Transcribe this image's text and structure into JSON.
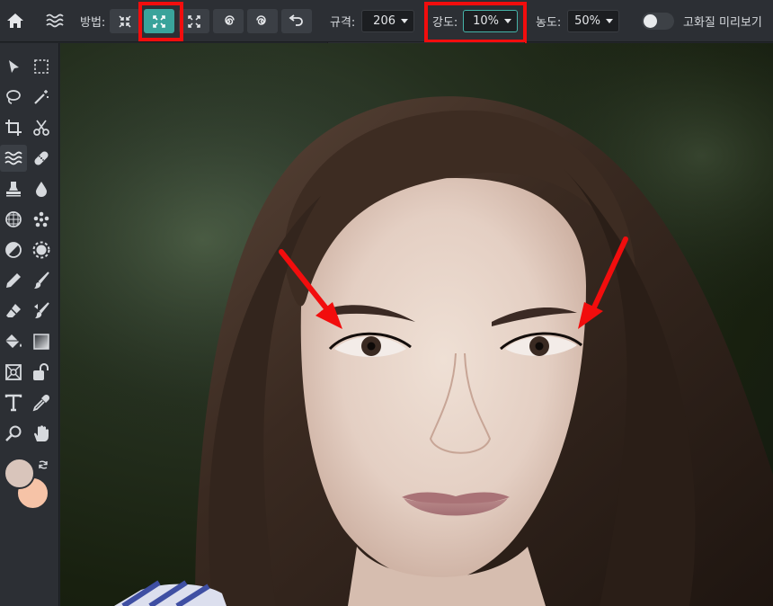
{
  "toolbar": {
    "method_label": "방법:",
    "scale_label": "규격:",
    "scale_value": "206",
    "strength_label": "강도:",
    "strength_value": "10%",
    "density_label": "농도:",
    "density_value": "50%",
    "hq_preview_label": "고화질 미리보기",
    "hq_preview_on": false,
    "method_buttons": [
      "shrink",
      "expand",
      "pinch",
      "twirl-cw",
      "twirl-ccw",
      "undo"
    ],
    "active_method": "expand"
  },
  "strength_slider": {
    "value": 0.1,
    "fill": 0.45
  },
  "colors": {
    "accent": "#3aa39b",
    "highlight": "#f20d0d",
    "primary_color": "#d9c5bb",
    "secondary_color": "#f6c3a7"
  },
  "tools": [
    "arrow-select-icon",
    "marquee-select-icon",
    "lasso-icon",
    "magic-wand-icon",
    "crop-icon",
    "scissors-icon",
    "liquify-icon",
    "healing-bandage-icon",
    "clone-stamp-icon",
    "blur-drop-icon",
    "sponge-icon",
    "dots-icon",
    "contrast-icon",
    "brightness-icon",
    "pencil-icon",
    "brush-icon",
    "eraser-icon",
    "color-replace-icon",
    "paint-bucket-icon",
    "gradient-icon",
    "placeholder-icon",
    "eraser-shape-icon",
    "text-icon",
    "eyedropper-icon",
    "zoom-icon",
    "hand-icon"
  ],
  "active_tool": "liquify-icon"
}
